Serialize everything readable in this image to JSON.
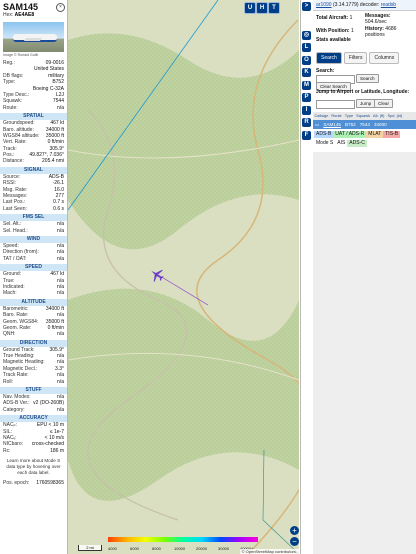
{
  "sidebar": {
    "callsign": "SAM145",
    "hex_label": "Hex:",
    "hex_value": "AE4AE8",
    "close_icon": "×",
    "photo_credit": "Image © Ronald Gullit",
    "info_rows": [
      {
        "k": "Reg.:",
        "v": "09-0016"
      },
      {
        "k": "",
        "v": "United States"
      },
      {
        "k": "DB flags:",
        "v": "military"
      },
      {
        "k": "Type:",
        "v": "B752"
      },
      {
        "k": "",
        "v": "Boeing C-32A"
      },
      {
        "k": "Type Desc.:",
        "v": "L2J"
      },
      {
        "k": "Squawk:",
        "v": "7544"
      },
      {
        "k": "Route:",
        "v": "n/a"
      }
    ],
    "spatial_title": "SPATIAL",
    "spatial_rows": [
      {
        "k": "Groundspeed:",
        "v": "467 kt"
      },
      {
        "k": "Baro. altitude:",
        "v": "34000 ft"
      },
      {
        "k": "WGS84 altitude:",
        "v": "35000 ft"
      },
      {
        "k": "Vert. Rate:",
        "v": "0 ft/min"
      },
      {
        "k": "Track:",
        "v": "305.9°"
      },
      {
        "k": "Pos.:",
        "v": "49.827°, 7.036°"
      },
      {
        "k": "Distance:",
        "v": "205.4 nmi"
      }
    ],
    "signal_title": "SIGNAL",
    "signal_rows": [
      {
        "k": "Source:",
        "v": "ADS-B"
      },
      {
        "k": "RSSI:",
        "v": "-26.1"
      },
      {
        "k": "Msg. Rate:",
        "v": "16.0"
      },
      {
        "k": "Messages:",
        "v": "277"
      },
      {
        "k": "Last Pos.:",
        "v": "0.7 s"
      },
      {
        "k": "Last Seen:",
        "v": "0.6 s"
      }
    ],
    "fms_title": "FMS SEL",
    "fms_rows": [
      {
        "k": "Sel. Alt.:",
        "v": "n/a"
      },
      {
        "k": "Sel. Head.:",
        "v": "n/a"
      }
    ],
    "wind_title": "WIND",
    "wind_rows": [
      {
        "k": "Speed:",
        "v": "n/a"
      },
      {
        "k": "Direction (from):",
        "v": "n/a"
      },
      {
        "k": "TAT / OAT:",
        "v": "n/a"
      }
    ],
    "speed_title": "SPEED",
    "speed_rows": [
      {
        "k": "Ground:",
        "v": "467 kt"
      },
      {
        "k": "True:",
        "v": "n/a"
      },
      {
        "k": "Indicated:",
        "v": "n/a"
      },
      {
        "k": "Mach:",
        "v": "n/a"
      }
    ],
    "altitude_title": "ALTITUDE",
    "altitude_rows": [
      {
        "k": "Barometric:",
        "v": "34000 ft"
      },
      {
        "k": "Baro. Rate:",
        "v": "n/a"
      },
      {
        "k": "Geom. WGS84:",
        "v": "35000 ft"
      },
      {
        "k": "Geom. Rate:",
        "v": "0 ft/min"
      },
      {
        "k": "QNH:",
        "v": "n/a"
      }
    ],
    "direction_title": "DIRECTION",
    "direction_rows": [
      {
        "k": "Ground Track:",
        "v": "305.9°"
      },
      {
        "k": "True Heading:",
        "v": "n/a"
      },
      {
        "k": "Magnetic Heading:",
        "v": "n/a"
      },
      {
        "k": "Magnetic Decl.:",
        "v": "3.3°"
      },
      {
        "k": "Track Rate:",
        "v": "n/a"
      },
      {
        "k": "Roll:",
        "v": "n/a"
      }
    ],
    "stuff_title": "STUFF",
    "stuff_rows": [
      {
        "k": "Nav. Modes:",
        "v": "n/a"
      },
      {
        "k": "ADS-B Ver.:",
        "v": "v2 (DO-260B)"
      },
      {
        "k": "Category:",
        "v": "n/a"
      }
    ],
    "accuracy_title": "ACCURACY",
    "accuracy_rows": [
      {
        "k": "NACₚ:",
        "v": "EPU < 10 m"
      },
      {
        "k": "SIL:",
        "v": "≤ 1e-7"
      },
      {
        "k": "NACᵥ:",
        "v": "< 10 m/s"
      },
      {
        "k": "NICbaro:",
        "v": "cross-checked"
      },
      {
        "k": "Rc:",
        "v": "186 m"
      }
    ],
    "learn_more": "Learn more about Mode S data type by hovering over each data label.",
    "pos_epoch_label": "Pos. epoch:",
    "pos_epoch_value": "1760598365"
  },
  "map": {
    "top_buttons": [
      "U",
      "H",
      "T"
    ],
    "zoom_in": "+",
    "zoom_out": "−",
    "attribution": "© OpenStreetMap contributors.",
    "scale_label": "2 mi",
    "alt_labels": [
      "4000",
      "6000",
      "8000",
      "10000",
      "20000",
      "30000",
      "40000+"
    ],
    "aircraft_icon": "plane-icon"
  },
  "toolbar": {
    "buttons": [
      ">",
      "◎",
      "L",
      "O",
      "K",
      "M",
      "P",
      "I",
      "R",
      "F"
    ]
  },
  "rightpanel": {
    "version_link": "ar1090",
    "version_text": "(3.14.1779) decoder:",
    "version_tail": "readsb",
    "total_aircraft_label": "Total Aircraft:",
    "total_aircraft_value": "1",
    "messages_label": "Messages:",
    "messages_value": "504.6/sec",
    "with_position_label": "With Position:",
    "with_position_value": "1",
    "history_label": "History:",
    "history_value": "4686 positions",
    "stats_label": "Stats available",
    "tabs": [
      "Search",
      "Filters",
      "Columns"
    ],
    "search_label": "Search:",
    "search_button": "Search",
    "clear_search_button": "Clear Search",
    "jump_label": "Jump to Airport or Latitude, Longitude:",
    "jump_button": "Jump",
    "clear_button": "Clear",
    "table_headers": [
      "Callsign",
      "Route",
      "Type",
      "Squawk",
      "Alt. (ft)",
      "Spd. (kt)"
    ],
    "table_row": {
      "callsign": "SAM145",
      "type": "B752",
      "squawk": "7544",
      "alt": "34000"
    },
    "legend": [
      "ADS-B",
      "UAT / ADS-R",
      "MLAT",
      "TIS-B",
      "Mode S",
      "AIS",
      "ADS-C"
    ],
    "colors": {
      "adsb": "#b8d8ff",
      "uat": "#aef0b4",
      "mlat": "#f4d3a4",
      "tisb": "#f4a9a9",
      "modes": "#ffffff",
      "ais": "#ffffff",
      "adsc": "#c8ecc8"
    }
  }
}
